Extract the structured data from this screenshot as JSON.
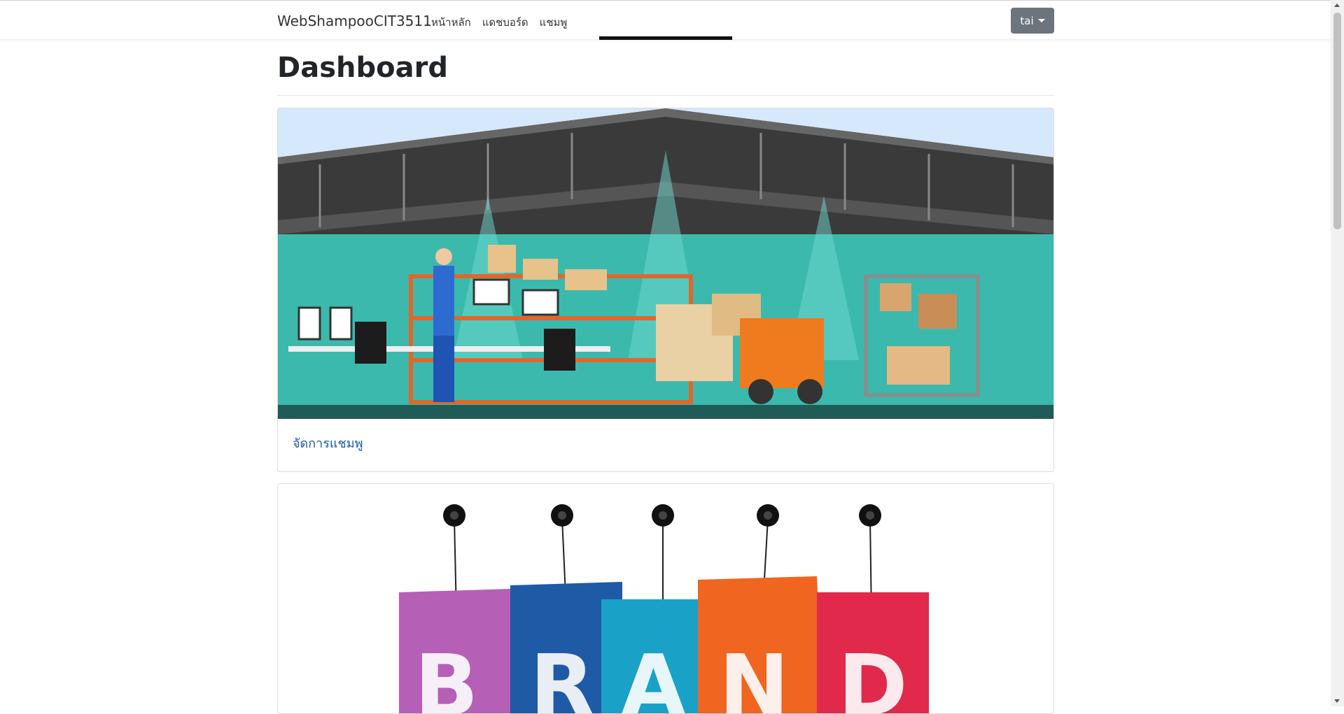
{
  "navbar": {
    "brand": "WebShampooCIT3511",
    "links": [
      "หน้าหลัก",
      "แดชบอร์ด",
      "แชมพู"
    ],
    "user_button": "tai"
  },
  "page": {
    "title": "Dashboard"
  },
  "cards": [
    {
      "image_alt": "warehouse illustration",
      "link_label": "จัดการแชมพู"
    },
    {
      "image_alt": "BRAND hanging tags",
      "brand_letters": [
        "B",
        "R",
        "A",
        "N",
        "D"
      ]
    }
  ],
  "colors": {
    "link": "#1d5aa8",
    "user_button_bg": "#6c757d",
    "navbar_indicator": "#111111"
  }
}
